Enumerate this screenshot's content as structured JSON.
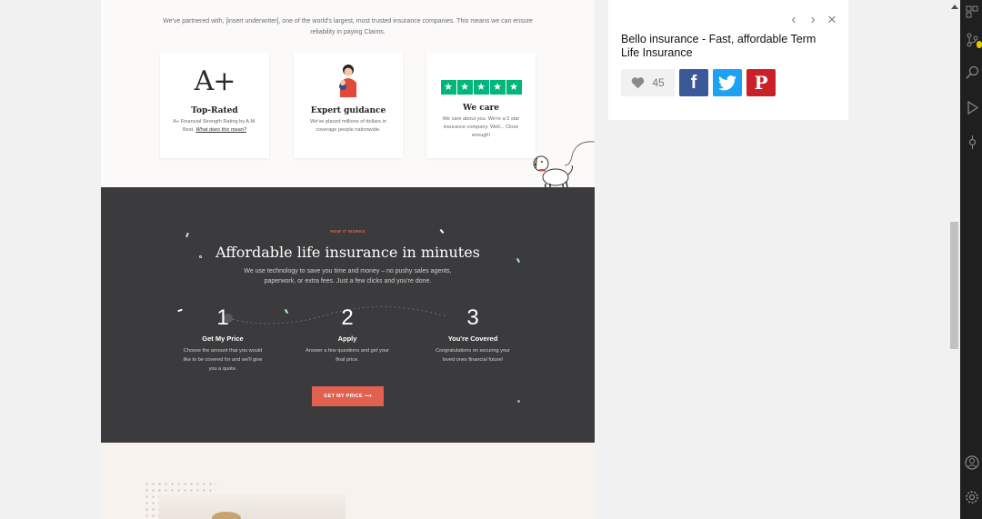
{
  "website": {
    "partner_text": "We've partnered with, [insert underwriter], one of the world's largest, most trusted insurance companies. This means we can ensure reliability in paying Claims.",
    "cards": [
      {
        "logo": "A+",
        "title": "Top-Rated",
        "text": "A+ Financial Strength Rating by A.M. Best.",
        "link": "What does this mean?"
      },
      {
        "title": "Expert guidance",
        "text": "We've placed millions of dollars in coverage people nationwide."
      },
      {
        "stars": "★★★★★",
        "title": "We care",
        "text": "We care about you. We're a 5 star insurance company. Well... Close enough!"
      }
    ],
    "how": {
      "eyebrow": "HOW IT WORKS",
      "title": "Affordable life insurance in minutes",
      "subtitle": "We use technology to save you time and money – no pushy sales agents, paperwork, or extra fees. Just a few clicks and you're done.",
      "steps": [
        {
          "num": "1",
          "title": "Get My Price",
          "text": "Choose the amount that you would like to be covered for and we'll give you a quote."
        },
        {
          "num": "2",
          "title": "Apply",
          "text": "Answer a few questions and get your final price."
        },
        {
          "num": "3",
          "title": "You're Covered",
          "text": "Congratulations on securing your loved ones financial future!"
        }
      ],
      "cta": "GET MY PRICE ⟶"
    }
  },
  "panel": {
    "title": "Bello insurance - Fast, affordable Term Life Insurance",
    "likes": "45",
    "nav": {
      "prev": "‹",
      "next": "›",
      "close": "✕"
    },
    "share": {
      "facebook": "f",
      "twitter": "t",
      "pinterest": "P"
    }
  },
  "icons": [
    "grid-icon",
    "source-control-icon",
    "search-icon",
    "run-debug-icon",
    "git-commit-icon",
    "account-icon",
    "settings-gear-icon"
  ],
  "colors": {
    "accent": "#e2604f",
    "dark_section": "#3b3b3d",
    "trustpilot": "#00b67a",
    "facebook": "#3b5998",
    "twitter": "#1da1f2",
    "pinterest": "#cb2027"
  }
}
